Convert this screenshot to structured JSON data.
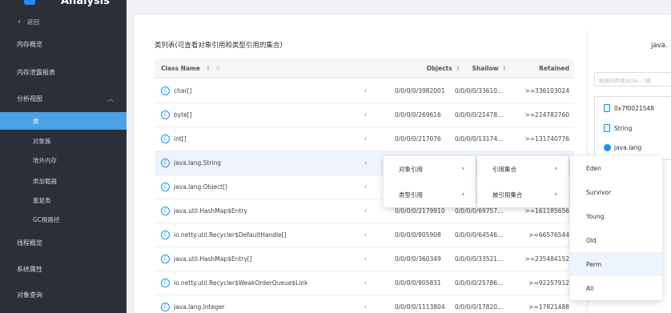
{
  "app": {
    "logo_text": "Analysis"
  },
  "sidebar": {
    "back_label": "返回",
    "items": [
      {
        "label": "内存概览"
      },
      {
        "label": "内存泄露报表"
      },
      {
        "label": "分析视图"
      },
      {
        "label": "线程概览"
      },
      {
        "label": "系统属性"
      },
      {
        "label": "对象查询"
      }
    ],
    "sub_items": [
      {
        "label": "类"
      },
      {
        "label": "对象簇"
      },
      {
        "label": "堆外内存"
      },
      {
        "label": "类加载器"
      },
      {
        "label": "重复类"
      },
      {
        "label": "GC根路径"
      }
    ]
  },
  "main": {
    "panel_title": "类列表(可查看对象引用和类型引用的集合)",
    "table": {
      "headers": {
        "class_name": "Class Name",
        "objects": "Objects",
        "shallow": "Shallow",
        "retained": "Retained"
      },
      "rows": [
        {
          "name": "char[]",
          "objects": "0/0/0/0/3982001",
          "shallow": "0/0/0/0/33610...",
          "retained": ">=336103024"
        },
        {
          "name": "byte[]",
          "objects": "0/0/0/0/269616",
          "shallow": "0/0/0/0/21478...",
          "retained": ">=214782760"
        },
        {
          "name": "int[]",
          "objects": "0/0/0/0/217076",
          "shallow": "0/0/0/0/13174...",
          "retained": ">=131740776"
        },
        {
          "name": "java.lang.String",
          "objects": "",
          "shallow": "",
          "retained": ""
        },
        {
          "name": "java.lang.Object[]",
          "objects": "",
          "shallow": "",
          "retained": ""
        },
        {
          "name": "java.util.HashMap$Entry",
          "objects": "0/0/0/0/2179910",
          "shallow": "0/0/0/0/69757...",
          "retained": ">=161185656"
        },
        {
          "name": "io.netty.util.Recycler$DefaultHandle[]",
          "objects": "0/0/0/0/805908",
          "shallow": "0/0/0/0/64546...",
          "retained": ">=66576544"
        },
        {
          "name": "java.util.HashMap$Entry[]",
          "objects": "0/0/0/0/360349",
          "shallow": "0/0/0/0/33521...",
          "retained": ">=235484152"
        },
        {
          "name": "io.netty.util.Recycler$WeakOrderQueue$Link",
          "objects": "0/0/0/0/805831",
          "shallow": "0/0/0/0/25786...",
          "retained": ">=92257912"
        },
        {
          "name": "java.lang.Integer",
          "objects": "0/0/0/0/1113804",
          "shallow": "0/0/0/0/17820...",
          "retained": ">=17821488"
        }
      ]
    }
  },
  "context_menu": {
    "level1": [
      {
        "label": "对象引用"
      },
      {
        "label": "类型引用"
      }
    ],
    "level2": [
      {
        "label": "引用集合"
      },
      {
        "label": "被引用集合"
      }
    ],
    "level3": [
      {
        "label": "Eden"
      },
      {
        "label": "Survivor"
      },
      {
        "label": "Young"
      },
      {
        "label": "Old"
      },
      {
        "label": "Perm"
      },
      {
        "label": "All"
      }
    ]
  },
  "right_panel": {
    "title": "java.",
    "search_placeholder": "根据内存地址(0x...)查",
    "items": [
      {
        "label": "0x7f0021548"
      },
      {
        "label": "String"
      },
      {
        "label": "java.lang"
      }
    ]
  }
}
